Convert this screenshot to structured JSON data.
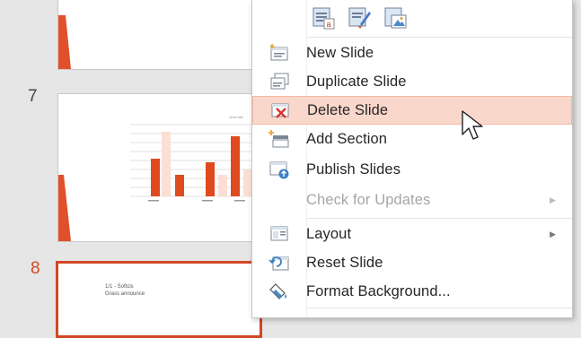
{
  "thumbnails": [
    {
      "number": "",
      "active": false
    },
    {
      "number": "7",
      "active": false
    },
    {
      "number": "8",
      "active": true,
      "text_line1": "1/1 - Softcis",
      "text_line2": "Grass announce"
    }
  ],
  "chart_thumb": {
    "title": "chart title"
  },
  "colors": {
    "accent": "#d24726",
    "hover_bg": "#fad7cb"
  },
  "menu": {
    "paste_options": [
      {
        "icon": "paste-keep-text-icon"
      },
      {
        "icon": "paste-format-painter-icon"
      },
      {
        "icon": "paste-picture-icon"
      }
    ],
    "items": [
      {
        "label": "New Slide",
        "icon": "new-slide-icon",
        "disabled": false,
        "submenu": false
      },
      {
        "label": "Duplicate Slide",
        "icon": "duplicate-slide-icon",
        "disabled": false,
        "submenu": false
      },
      {
        "label": "Delete Slide",
        "icon": "delete-slide-icon",
        "disabled": false,
        "submenu": false,
        "hovered": true
      },
      {
        "label": "Add Section",
        "icon": "add-section-icon",
        "disabled": false,
        "submenu": false
      },
      {
        "label": "Publish Slides",
        "icon": "publish-slides-icon",
        "disabled": false,
        "submenu": false
      },
      {
        "label": "Check for Updates",
        "icon": "",
        "disabled": true,
        "submenu": true
      },
      {
        "label": "Layout",
        "icon": "layout-icon",
        "disabled": false,
        "submenu": true
      },
      {
        "label": "Reset Slide",
        "icon": "reset-slide-icon",
        "disabled": false,
        "submenu": false
      },
      {
        "label": "Format Background...",
        "icon": "format-background-icon",
        "disabled": false,
        "submenu": false
      }
    ]
  }
}
